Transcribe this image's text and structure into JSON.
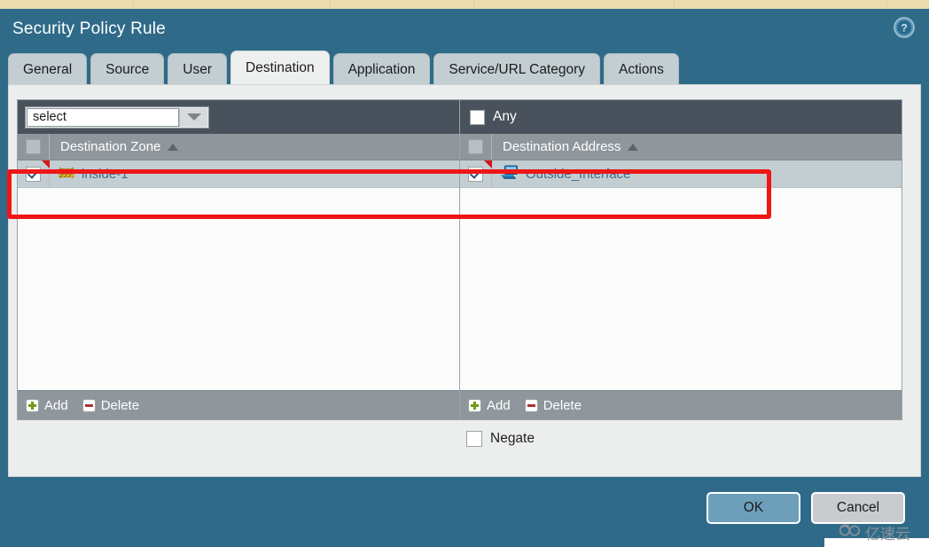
{
  "window": {
    "title": "Security Policy Rule",
    "help_icon": "help-circle-icon"
  },
  "tabs": [
    {
      "label": "General",
      "active": false
    },
    {
      "label": "Source",
      "active": false
    },
    {
      "label": "User",
      "active": false
    },
    {
      "label": "Destination",
      "active": true
    },
    {
      "label": "Application",
      "active": false
    },
    {
      "label": "Service/URL Category",
      "active": false
    },
    {
      "label": "Actions",
      "active": false
    }
  ],
  "destination": {
    "zone_panel": {
      "select": {
        "value": "select",
        "placeholder": "select",
        "arrow_icon": "chevron-down-icon"
      },
      "column_header": "Destination Zone",
      "sort_icon": "sort-ascending-icon",
      "header_checkbox_checked": false,
      "rows": [
        {
          "label": "inside-1",
          "icon": "zone-barrier-icon",
          "checked": true
        }
      ],
      "footer": {
        "add_label": "Add",
        "add_icon": "plus-icon",
        "delete_label": "Delete",
        "delete_icon": "minus-icon"
      }
    },
    "address_panel": {
      "any_label": "Any",
      "any_checked": false,
      "column_header": "Destination Address",
      "sort_icon": "sort-ascending-icon",
      "header_checkbox_checked": false,
      "rows": [
        {
          "label": "Outside_Interface",
          "icon": "monitor-icon",
          "checked": true
        }
      ],
      "footer": {
        "add_label": "Add",
        "add_icon": "plus-icon",
        "delete_label": "Delete",
        "delete_icon": "minus-icon"
      }
    },
    "negate": {
      "label": "Negate",
      "checked": false
    }
  },
  "footer": {
    "ok_label": "OK",
    "cancel_label": "Cancel"
  },
  "watermark": {
    "text": "亿速云",
    "icon": "cloud-logo-icon"
  },
  "colors": {
    "dialog_background": "#2f6b89",
    "tab_inactive": "#c3ced3",
    "tab_active": "#eef0f0",
    "panel_toolbar": "#49525c",
    "column_header": "#8f979d",
    "row_selected": "#c3ced3",
    "link_text": "#3d6e8a",
    "annotation_red": "#f01616",
    "ok_button": "#6d9fbb",
    "cancel_button": "#c8ccce",
    "top_strip": "#ecdcb0"
  }
}
